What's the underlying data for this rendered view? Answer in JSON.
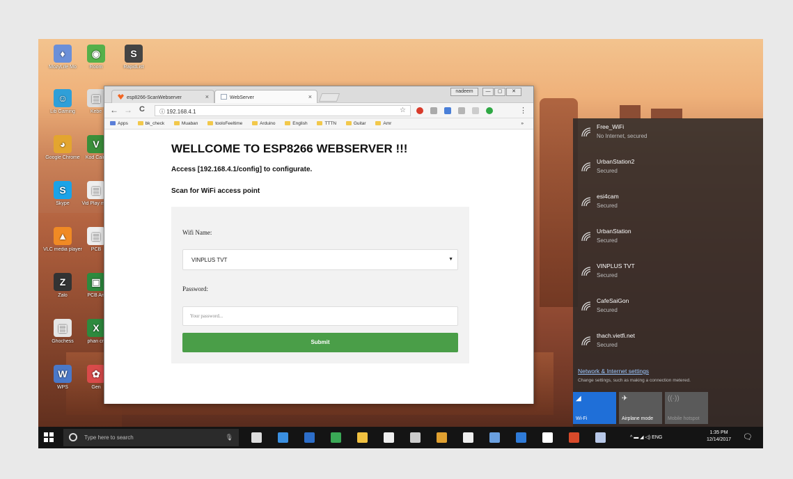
{
  "desktop": {
    "icons": [
      {
        "label": "MozyLife Mo",
        "color": "#6b8fd8",
        "glyph": "♦",
        "pos": 0
      },
      {
        "label": "Room",
        "color": "#55b04a",
        "glyph": "◉",
        "pos": 1
      },
      {
        "label": "RapidList",
        "color": "#444444",
        "glyph": "S",
        "pos": 2
      },
      {
        "label": "Lib Gaming",
        "color": "#2f9fd8",
        "glyph": "☺",
        "pos": 3
      },
      {
        "label": "Kebe",
        "color": "#dddddd",
        "glyph": "▤",
        "pos": 4
      },
      {
        "label": "Google Chrome",
        "color": "#e3a52f",
        "glyph": "◕",
        "pos": 5
      },
      {
        "label": "Kod Calib",
        "color": "#3a8f3a",
        "glyph": "V",
        "pos": 6
      },
      {
        "label": "Skype",
        "color": "#1aa3e8",
        "glyph": "S",
        "pos": 7
      },
      {
        "label": "Vid Play med",
        "color": "#eeeeee",
        "glyph": "▤",
        "pos": 8
      },
      {
        "label": "VLC media player",
        "color": "#f08a24",
        "glyph": "▲",
        "pos": 9
      },
      {
        "label": "PCB",
        "color": "#eeeeee",
        "glyph": "▤",
        "pos": 10
      },
      {
        "label": "Zalo",
        "color": "#333333",
        "glyph": "Z",
        "pos": 11
      },
      {
        "label": "PCB Arr",
        "color": "#2d8a3e",
        "glyph": "▣",
        "pos": 12
      },
      {
        "label": "Ghochess",
        "color": "#e6e6e6",
        "glyph": "▤",
        "pos": 13
      },
      {
        "label": "phan cn",
        "color": "#2d8a3e",
        "glyph": "X",
        "pos": 14
      },
      {
        "label": "WPS",
        "color": "#4a78c8",
        "glyph": "W",
        "pos": 15
      },
      {
        "label": "Gen",
        "color": "#d94a4a",
        "glyph": "✿",
        "pos": 16
      }
    ]
  },
  "browser": {
    "tabs": [
      {
        "label": "esp8266-ScanWebserver",
        "close": "×",
        "fav": "#f26522"
      },
      {
        "label": "WebServer",
        "close": "×",
        "fav": "#9aa7b8"
      }
    ],
    "window_user": "nadeem",
    "window_controls": [
      "—",
      "▢",
      "✕"
    ],
    "nav": {
      "back": "←",
      "forward": "→",
      "reload": "C"
    },
    "url": "ⓘ 192.168.4.1",
    "star": "☆",
    "bookmarks": [
      "Apps",
      "bk_check",
      "Muaban",
      "tooloFeeltime",
      "Arduino",
      "English",
      "TTTN",
      "Guitar",
      "Amr"
    ],
    "bookmarks_more": "»",
    "extensions": [
      {
        "color": "#d83b2b"
      },
      {
        "color": "#aaaaaa"
      },
      {
        "color": "#4a7fd8"
      },
      {
        "color": "#b5b5b5"
      },
      {
        "color": "#cccccc"
      },
      {
        "color": "#2fa844"
      }
    ],
    "menu": "⋮"
  },
  "page": {
    "heading": "WELLCOME TO ESP8266 WEBSERVER !!!",
    "access": "Access [192.168.4.1/config] to configurate.",
    "scan": "Scan for WiFi access point",
    "form": {
      "wifi_label": "Wifi Name:",
      "wifi_selected": "VINPLUS TVT",
      "select_arrow": "▼",
      "password_label": "Password:",
      "password_placeholder": "Your password...",
      "submit_label": "Submit"
    }
  },
  "wifi_panel": {
    "networks": [
      {
        "name": "Free_WiFi",
        "status": "No Internet, secured"
      },
      {
        "name": "UrbanStation2",
        "status": "Secured"
      },
      {
        "name": "esi4cam",
        "status": "Secured"
      },
      {
        "name": "UrbanStation",
        "status": "Secured"
      },
      {
        "name": "VINPLUS TVT",
        "status": "Secured"
      },
      {
        "name": "CafeSaiGon",
        "status": "Secured"
      },
      {
        "name": "thach.vietfi.net",
        "status": "Secured"
      }
    ],
    "settings_link": "Network & Internet settings",
    "settings_sub": "Change settings, such as making a connection metered.",
    "quick_actions": [
      {
        "label": "Wi-Fi",
        "icon": "◢",
        "color": "#1f6fd8",
        "dim": false
      },
      {
        "label": "Airplane mode",
        "icon": "✈",
        "color": "#5a5a5a",
        "dim": false
      },
      {
        "label": "Mobile hotspot",
        "icon": "((·))",
        "color": "#5a5a5a",
        "dim": true
      }
    ]
  },
  "taskbar": {
    "search_placeholder": "Type here to search",
    "mic": "🎙",
    "apps": [
      "#dddddd",
      "#3a8fe0",
      "#2d6ec9",
      "#3aa856",
      "#f0c040",
      "#eeeeee",
      "#cccccc",
      "#e0a030",
      "#eeeeee",
      "#6aa0e0",
      "#2f7bd8",
      "#ffffff",
      "#d84a2a",
      "#b8c8e8"
    ],
    "tray_text": "^ ▬ ◢ ◁) ENG",
    "time": "1:35 PM",
    "date": "12/14/2017",
    "notification": "🗨"
  }
}
